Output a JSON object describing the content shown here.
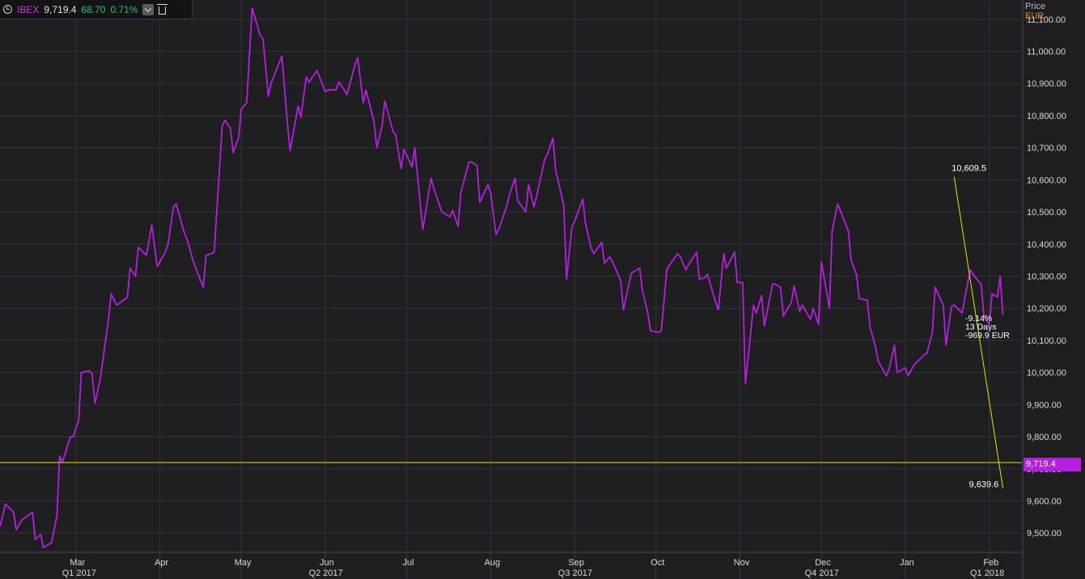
{
  "header": {
    "symbol": "IBEX",
    "last": "9,719.4",
    "change": "68.70",
    "change_pct": "0.71%",
    "icons": [
      "clock-icon",
      "chevron-down-icon",
      "trash-icon"
    ]
  },
  "axis_header": {
    "price_label": "Price",
    "currency": "EUR"
  },
  "current_price_tag": "9,719.4",
  "annotations": {
    "high_label": "10,609.5",
    "low_label": "9,639.6",
    "measure": [
      "-9.14%",
      "13 Days",
      "-969.9 EUR"
    ]
  },
  "colors": {
    "background": "#1f1f21",
    "grid": "#343438",
    "series": "#b520e0",
    "price_line": "#e6e600",
    "axis_text": "#d8d8d8",
    "change_positive": "#2fc06a",
    "currency": "#e08a2e"
  },
  "chart_data": {
    "type": "line",
    "title": "",
    "ylabel": "Price",
    "yunit": "EUR",
    "ylim": [
      9440,
      11160
    ],
    "ytick_values": [
      9500,
      9600,
      9700,
      9800,
      9900,
      10000,
      10100,
      10200,
      10300,
      10400,
      10500,
      10600,
      10700,
      10800,
      10900,
      11000,
      11100
    ],
    "ytick_labels": [
      "9,500.00",
      "9,600.00",
      "9,700.00",
      "9,800.00",
      "9,900.00",
      "10,000.00",
      "10,100.00",
      "10,200.00",
      "10,300.00",
      "10,400.00",
      "10,500.00",
      "10,600.00",
      "10,700.00",
      "10,800.00",
      "10,900.00",
      "11,000.00",
      "11,100.00"
    ],
    "x_start": "2017-02-01",
    "x_end": "2018-02-13",
    "month_ticks": [
      {
        "date": "2017-03-01",
        "label": "Mar"
      },
      {
        "date": "2017-04-01",
        "label": "Apr"
      },
      {
        "date": "2017-05-01",
        "label": "May"
      },
      {
        "date": "2017-06-01",
        "label": "Jun"
      },
      {
        "date": "2017-07-01",
        "label": "Jul"
      },
      {
        "date": "2017-08-01",
        "label": "Aug"
      },
      {
        "date": "2017-09-01",
        "label": "Sep"
      },
      {
        "date": "2017-10-01",
        "label": "Oct"
      },
      {
        "date": "2017-11-01",
        "label": "Nov"
      },
      {
        "date": "2017-12-01",
        "label": "Dec"
      },
      {
        "date": "2018-01-01",
        "label": "Jan"
      },
      {
        "date": "2018-02-01",
        "label": "Feb"
      }
    ],
    "quarter_ticks": [
      {
        "date": "2017-03-01",
        "label": "Q1 2017"
      },
      {
        "date": "2017-05-31",
        "label": "Q2 2017"
      },
      {
        "date": "2017-08-31",
        "label": "Q3 2017"
      },
      {
        "date": "2017-11-30",
        "label": "Q4 2017"
      },
      {
        "date": "2018-01-30",
        "label": "Q1 2018"
      }
    ],
    "grid": true,
    "series": [
      {
        "name": "IBEX",
        "points": [
          [
            "2017-02-01",
            9520
          ],
          [
            "2017-02-03",
            9590
          ],
          [
            "2017-02-06",
            9565
          ],
          [
            "2017-02-07",
            9510
          ],
          [
            "2017-02-09",
            9540
          ],
          [
            "2017-02-13",
            9565
          ],
          [
            "2017-02-14",
            9480
          ],
          [
            "2017-02-16",
            9495
          ],
          [
            "2017-02-17",
            9455
          ],
          [
            "2017-02-20",
            9470
          ],
          [
            "2017-02-22",
            9555
          ],
          [
            "2017-02-23",
            9740
          ],
          [
            "2017-02-24",
            9720
          ],
          [
            "2017-02-27",
            9800
          ],
          [
            "2017-02-28",
            9800
          ],
          [
            "2017-03-02",
            9850
          ],
          [
            "2017-03-03",
            10000
          ],
          [
            "2017-03-06",
            10005
          ],
          [
            "2017-03-07",
            9995
          ],
          [
            "2017-03-08",
            9905
          ],
          [
            "2017-03-10",
            9980
          ],
          [
            "2017-03-13",
            10165
          ],
          [
            "2017-03-14",
            10245
          ],
          [
            "2017-03-16",
            10210
          ],
          [
            "2017-03-17",
            10215
          ],
          [
            "2017-03-20",
            10235
          ],
          [
            "2017-03-21",
            10325
          ],
          [
            "2017-03-23",
            10300
          ],
          [
            "2017-03-24",
            10390
          ],
          [
            "2017-03-27",
            10365
          ],
          [
            "2017-03-29",
            10460
          ],
          [
            "2017-03-31",
            10330
          ],
          [
            "2017-04-03",
            10375
          ],
          [
            "2017-04-04",
            10400
          ],
          [
            "2017-04-06",
            10515
          ],
          [
            "2017-04-07",
            10525
          ],
          [
            "2017-04-10",
            10435
          ],
          [
            "2017-04-11",
            10415
          ],
          [
            "2017-04-13",
            10355
          ],
          [
            "2017-04-14",
            10330
          ],
          [
            "2017-04-17",
            10265
          ],
          [
            "2017-04-18",
            10365
          ],
          [
            "2017-04-20",
            10370
          ],
          [
            "2017-04-21",
            10375
          ],
          [
            "2017-04-24",
            10770
          ],
          [
            "2017-04-25",
            10785
          ],
          [
            "2017-04-27",
            10760
          ],
          [
            "2017-04-28",
            10685
          ],
          [
            "2017-04-30",
            10730
          ],
          [
            "2017-05-01",
            10820
          ],
          [
            "2017-05-03",
            10840
          ],
          [
            "2017-05-04",
            10985
          ],
          [
            "2017-05-05",
            11135
          ],
          [
            "2017-05-08",
            11050
          ],
          [
            "2017-05-09",
            11040
          ],
          [
            "2017-05-11",
            10860
          ],
          [
            "2017-05-12",
            10900
          ],
          [
            "2017-05-15",
            10965
          ],
          [
            "2017-05-16",
            10985
          ],
          [
            "2017-05-18",
            10780
          ],
          [
            "2017-05-19",
            10690
          ],
          [
            "2017-05-22",
            10830
          ],
          [
            "2017-05-23",
            10795
          ],
          [
            "2017-05-25",
            10920
          ],
          [
            "2017-05-26",
            10905
          ],
          [
            "2017-05-29",
            10940
          ],
          [
            "2017-05-31",
            10895
          ],
          [
            "2017-06-01",
            10875
          ],
          [
            "2017-06-02",
            10880
          ],
          [
            "2017-06-05",
            10880
          ],
          [
            "2017-06-06",
            10905
          ],
          [
            "2017-06-08",
            10880
          ],
          [
            "2017-06-09",
            10865
          ],
          [
            "2017-06-12",
            10960
          ],
          [
            "2017-06-13",
            10980
          ],
          [
            "2017-06-15",
            10840
          ],
          [
            "2017-06-16",
            10880
          ],
          [
            "2017-06-19",
            10780
          ],
          [
            "2017-06-20",
            10700
          ],
          [
            "2017-06-22",
            10770
          ],
          [
            "2017-06-23",
            10845
          ],
          [
            "2017-06-26",
            10750
          ],
          [
            "2017-06-27",
            10740
          ],
          [
            "2017-06-29",
            10635
          ],
          [
            "2017-06-30",
            10695
          ],
          [
            "2017-07-03",
            10640
          ],
          [
            "2017-07-04",
            10700
          ],
          [
            "2017-07-06",
            10530
          ],
          [
            "2017-07-07",
            10445
          ],
          [
            "2017-07-10",
            10605
          ],
          [
            "2017-07-11",
            10575
          ],
          [
            "2017-07-13",
            10525
          ],
          [
            "2017-07-14",
            10500
          ],
          [
            "2017-07-17",
            10485
          ],
          [
            "2017-07-18",
            10505
          ],
          [
            "2017-07-20",
            10455
          ],
          [
            "2017-07-21",
            10560
          ],
          [
            "2017-07-24",
            10655
          ],
          [
            "2017-07-25",
            10655
          ],
          [
            "2017-07-27",
            10645
          ],
          [
            "2017-07-28",
            10530
          ],
          [
            "2017-07-31",
            10585
          ],
          [
            "2017-08-01",
            10560
          ],
          [
            "2017-08-03",
            10430
          ],
          [
            "2017-08-04",
            10445
          ],
          [
            "2017-08-07",
            10520
          ],
          [
            "2017-08-08",
            10555
          ],
          [
            "2017-08-10",
            10605
          ],
          [
            "2017-08-11",
            10535
          ],
          [
            "2017-08-14",
            10500
          ],
          [
            "2017-08-15",
            10585
          ],
          [
            "2017-08-17",
            10515
          ],
          [
            "2017-08-18",
            10550
          ],
          [
            "2017-08-21",
            10665
          ],
          [
            "2017-08-22",
            10680
          ],
          [
            "2017-08-24",
            10730
          ],
          [
            "2017-08-25",
            10630
          ],
          [
            "2017-08-28",
            10520
          ],
          [
            "2017-08-29",
            10290
          ],
          [
            "2017-08-31",
            10455
          ],
          [
            "2017-09-01",
            10470
          ],
          [
            "2017-09-04",
            10540
          ],
          [
            "2017-09-05",
            10465
          ],
          [
            "2017-09-07",
            10390
          ],
          [
            "2017-09-08",
            10370
          ],
          [
            "2017-09-11",
            10405
          ],
          [
            "2017-09-12",
            10340
          ],
          [
            "2017-09-14",
            10360
          ],
          [
            "2017-09-15",
            10345
          ],
          [
            "2017-09-18",
            10285
          ],
          [
            "2017-09-19",
            10195
          ],
          [
            "2017-09-21",
            10275
          ],
          [
            "2017-09-22",
            10310
          ],
          [
            "2017-09-25",
            10325
          ],
          [
            "2017-09-26",
            10255
          ],
          [
            "2017-09-28",
            10185
          ],
          [
            "2017-09-29",
            10130
          ],
          [
            "2017-10-02",
            10125
          ],
          [
            "2017-10-03",
            10130
          ],
          [
            "2017-10-05",
            10320
          ],
          [
            "2017-10-06",
            10335
          ],
          [
            "2017-10-09",
            10370
          ],
          [
            "2017-10-10",
            10360
          ],
          [
            "2017-10-12",
            10320
          ],
          [
            "2017-10-13",
            10335
          ],
          [
            "2017-10-16",
            10375
          ],
          [
            "2017-10-17",
            10290
          ],
          [
            "2017-10-19",
            10295
          ],
          [
            "2017-10-20",
            10305
          ],
          [
            "2017-10-23",
            10220
          ],
          [
            "2017-10-24",
            10195
          ],
          [
            "2017-10-26",
            10370
          ],
          [
            "2017-10-27",
            10325
          ],
          [
            "2017-10-30",
            10375
          ],
          [
            "2017-10-31",
            10280
          ],
          [
            "2017-11-02",
            10280
          ],
          [
            "2017-11-03",
            9965
          ],
          [
            "2017-11-06",
            10210
          ],
          [
            "2017-11-07",
            10185
          ],
          [
            "2017-11-09",
            10240
          ],
          [
            "2017-11-10",
            10145
          ],
          [
            "2017-11-13",
            10275
          ],
          [
            "2017-11-14",
            10275
          ],
          [
            "2017-11-16",
            10265
          ],
          [
            "2017-11-17",
            10175
          ],
          [
            "2017-11-20",
            10220
          ],
          [
            "2017-11-21",
            10270
          ],
          [
            "2017-11-23",
            10190
          ],
          [
            "2017-11-24",
            10210
          ],
          [
            "2017-11-27",
            10165
          ],
          [
            "2017-11-28",
            10200
          ],
          [
            "2017-11-30",
            10150
          ],
          [
            "2017-12-01",
            10345
          ],
          [
            "2017-12-04",
            10200
          ],
          [
            "2017-12-05",
            10440
          ],
          [
            "2017-12-07",
            10525
          ],
          [
            "2017-12-08",
            10505
          ],
          [
            "2017-12-11",
            10440
          ],
          [
            "2017-12-12",
            10350
          ],
          [
            "2017-12-14",
            10305
          ],
          [
            "2017-12-15",
            10230
          ],
          [
            "2017-12-18",
            10225
          ],
          [
            "2017-12-19",
            10140
          ],
          [
            "2017-12-21",
            10080
          ],
          [
            "2017-12-22",
            10035
          ],
          [
            "2017-12-25",
            9990
          ],
          [
            "2017-12-26",
            10010
          ],
          [
            "2017-12-28",
            10085
          ],
          [
            "2017-12-29",
            10000
          ],
          [
            "2018-01-01",
            10015
          ],
          [
            "2018-01-02",
            9990
          ],
          [
            "2018-01-04",
            10020
          ],
          [
            "2018-01-05",
            10030
          ],
          [
            "2018-01-08",
            10055
          ],
          [
            "2018-01-09",
            10060
          ],
          [
            "2018-01-11",
            10125
          ],
          [
            "2018-01-12",
            10265
          ],
          [
            "2018-01-15",
            10210
          ],
          [
            "2018-01-16",
            10085
          ],
          [
            "2018-01-18",
            10205
          ],
          [
            "2018-01-19",
            10210
          ],
          [
            "2018-01-22",
            10185
          ],
          [
            "2018-01-23",
            10235
          ],
          [
            "2018-01-25",
            10320
          ],
          [
            "2018-01-26",
            10305
          ],
          [
            "2018-01-29",
            10275
          ],
          [
            "2018-01-30",
            10175
          ],
          [
            "2018-02-01",
            10150
          ],
          [
            "2018-02-02",
            10245
          ],
          [
            "2018-02-04",
            10235
          ],
          [
            "2018-02-05",
            10300
          ],
          [
            "2018-02-06",
            10180
          ]
        ]
      }
    ]
  }
}
